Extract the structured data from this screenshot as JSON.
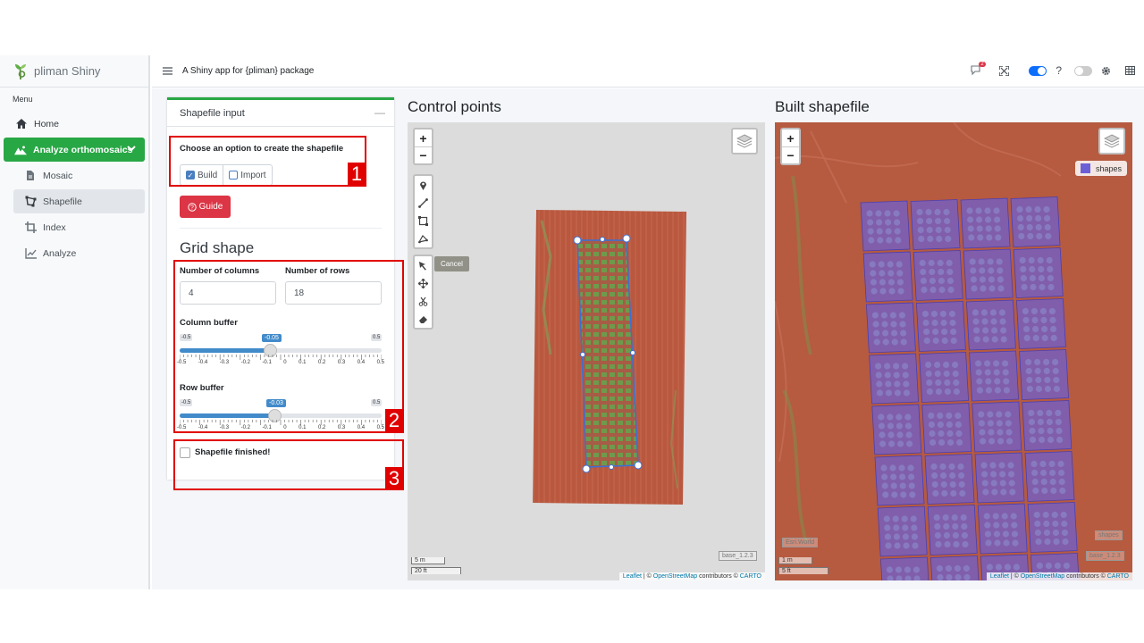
{
  "sidebar": {
    "brand": "pliman Shiny",
    "menu_label": "Menu",
    "items": [
      {
        "label": "Home"
      },
      {
        "label": "Analyze orthomosaics"
      },
      {
        "label": "Mosaic"
      },
      {
        "label": "Shapefile"
      },
      {
        "label": "Index"
      },
      {
        "label": "Analyze"
      }
    ]
  },
  "header": {
    "title": "A Shiny app for {pliman} package",
    "notification_count": "2",
    "help_label": "?"
  },
  "shapefile_card": {
    "title": "Shapefile input",
    "option_prompt": "Choose an option to create the shapefile",
    "build_label": "Build",
    "import_label": "Import",
    "guide_label": "Guide",
    "grid_title": "Grid shape",
    "columns_label": "Number of columns",
    "columns_value": "4",
    "rows_label": "Number of rows",
    "rows_value": "18",
    "col_buffer_label": "Column buffer",
    "col_buffer": {
      "min": "-0.5",
      "max": "0.5",
      "value": "-0.05",
      "fraction": 0.45
    },
    "row_buffer_label": "Row buffer",
    "row_buffer": {
      "min": "-0.5",
      "max": "0.5",
      "value": "-0.03",
      "fraction": 0.47
    },
    "ticks": [
      "-0.5",
      "-0.4",
      "-0.3",
      "-0.2",
      "-0.1",
      "0",
      "0.1",
      "0.2",
      "0.3",
      "0.4",
      "0.5"
    ],
    "finished_label": "Shapefile finished!"
  },
  "annotations": [
    "1",
    "2",
    "3"
  ],
  "control_points": {
    "title": "Control points",
    "cancel_label": "Cancel",
    "scale_m": "5 m",
    "scale_ft": "20 ft",
    "layer_label": "base_1.2.3",
    "attribution_leaflet": "Leaflet",
    "attribution_mid": " | © ",
    "attribution_osm": "OpenStreetMap",
    "attribution_contrib": " contributors © ",
    "attribution_carto": "CARTO"
  },
  "built_shapefile": {
    "title": "Built shapefile",
    "legend_label": "shapes",
    "scale_m": "1 m",
    "scale_ft": "5 ft",
    "faint_label_1": "Esri.World",
    "faint_label_2": "shapes",
    "layer_label": "base_1.2.3",
    "attribution_leaflet": "Leaflet",
    "attribution_mid": " | © ",
    "attribution_osm": "OpenStreetMap",
    "attribution_contrib": " contributors © ",
    "attribution_carto": "CARTO"
  },
  "colors": {
    "accent_green": "#28a745",
    "danger_red": "#dc3545",
    "annotation_red": "#e10000",
    "slider_blue": "#428bca",
    "soil": "#b5533a",
    "plot_fill": "#6b5fd6"
  }
}
